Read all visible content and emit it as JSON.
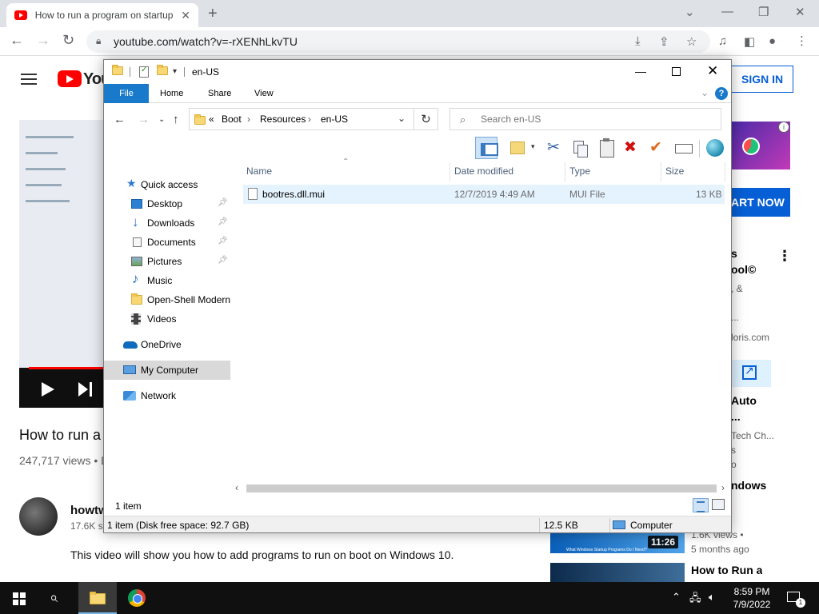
{
  "browser": {
    "tab_title": "How to run a program on startup",
    "url": "youtube.com/watch?v=-rXENhLkvTU"
  },
  "youtube": {
    "logo_text": "You",
    "signin_label": "SIGN IN",
    "video_title": "How to run a",
    "views": "247,717 views • D",
    "channel_name": "howtw",
    "channel_subs": "17.6K s",
    "description": "This video will show you how to add programs to run on boot on Windows 10.",
    "ad_button": "ART NOW",
    "sidebar": {
      "t1": "s",
      "t2": "ool©",
      "t3": ", &",
      "t4": "...",
      "t5": "loris.com",
      "t6": "Auto",
      "t7": "...",
      "t8": "Tech Ch...",
      "t9": "s",
      "t10": "o",
      "t11": "ndows",
      "v1_views": "1.6K views •",
      "v1_age": "5 months ago",
      "v1_duration": "11:26",
      "v1_thumb_caption": "What Windows Startup Programs Do I Need?",
      "v2_title": "How to Run a"
    }
  },
  "explorer": {
    "title": "en-US",
    "ribbon_tabs": [
      "File",
      "Home",
      "Share",
      "View"
    ],
    "breadcrumb": [
      "Boot",
      "Resources",
      "en-US"
    ],
    "breadcrumb_prefix": "«",
    "search_placeholder": "Search en-US",
    "nav": {
      "quick_access": "Quick access",
      "desktop": "Desktop",
      "downloads": "Downloads",
      "documents": "Documents",
      "pictures": "Pictures",
      "music": "Music",
      "openshell": "Open-Shell Modern",
      "videos": "Videos",
      "onedrive": "OneDrive",
      "mycomputer": "My Computer",
      "network": "Network"
    },
    "columns": {
      "name": "Name",
      "date": "Date modified",
      "type": "Type",
      "size": "Size"
    },
    "files": [
      {
        "name": "bootres.dll.mui",
        "date": "12/7/2019 4:49 AM",
        "type": "MUI File",
        "size": "13 KB"
      }
    ],
    "status_count": "1 item",
    "status_disk": "1 item (Disk free space: 92.7 GB)",
    "status_size": "12.5 KB",
    "status_location": "Computer"
  },
  "taskbar": {
    "time": "8:59 PM",
    "date": "7/9/2022",
    "notification_count": "1"
  }
}
